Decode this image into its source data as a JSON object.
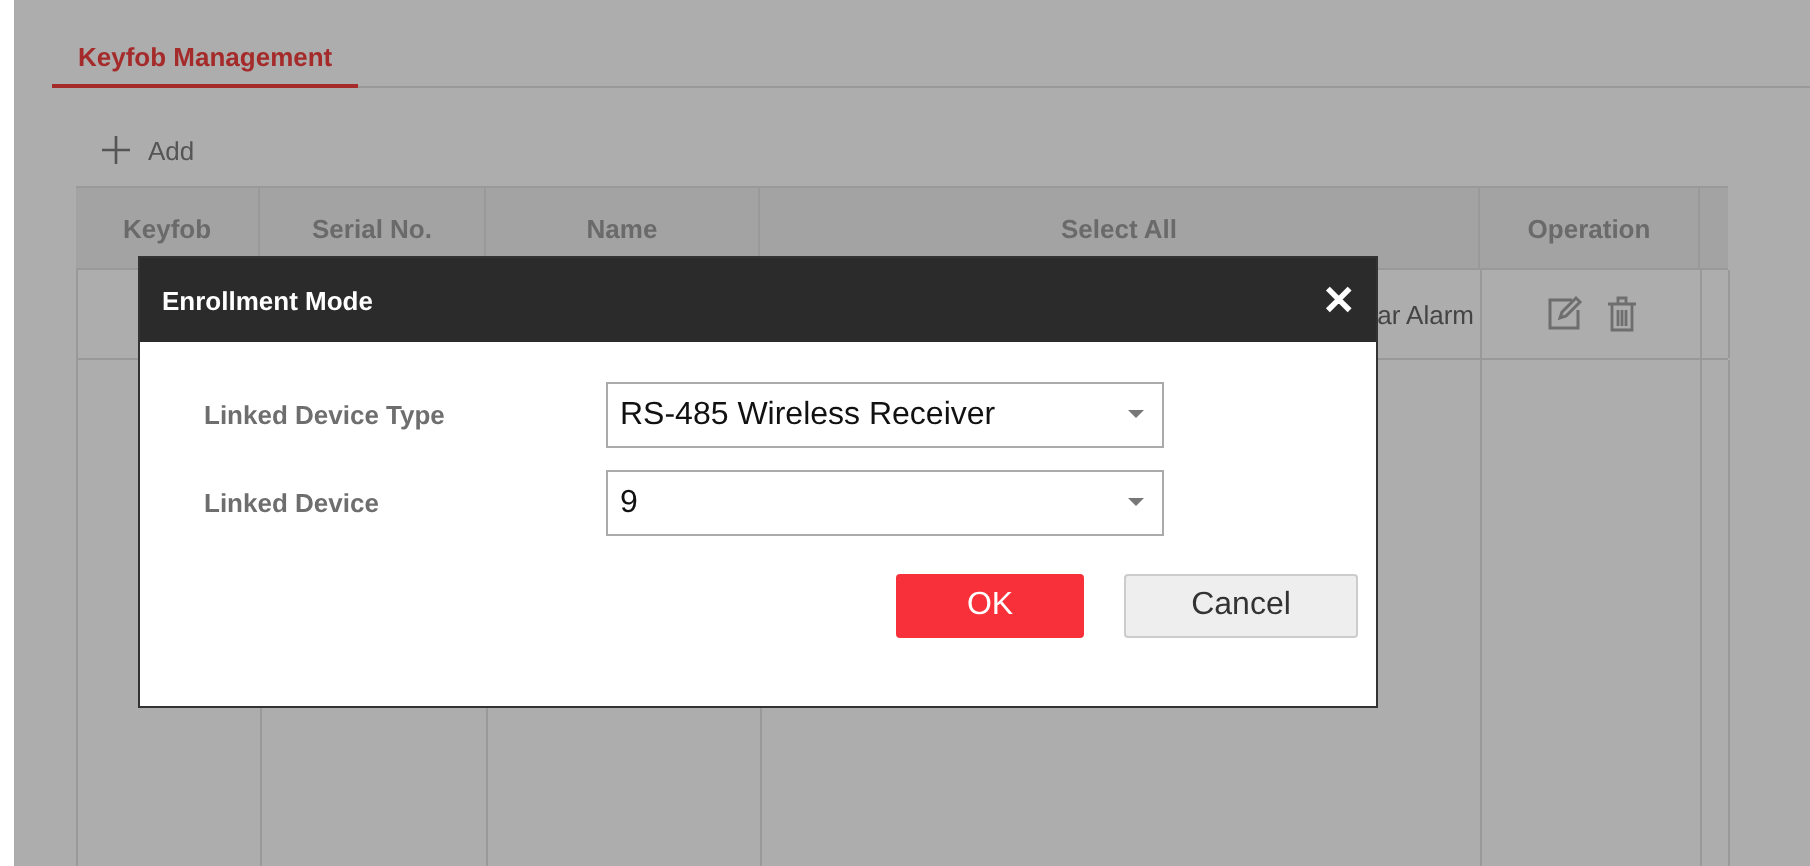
{
  "tabs": [
    {
      "label": "Keyfob Management",
      "selected": true
    }
  ],
  "add_button": {
    "label": "Add"
  },
  "table": {
    "columns": [
      "Keyfob",
      "Serial No.",
      "Name",
      "Select All",
      "Operation"
    ],
    "rows": [
      {
        "cells": [
          "",
          "",
          "",
          "ar Alarm"
        ]
      }
    ]
  },
  "dialog": {
    "title": "Enrollment Mode",
    "close": "✕",
    "fields": [
      {
        "label": "Linked Device Type",
        "value": "RS-485 Wireless Receiver"
      },
      {
        "label": "Linked Device",
        "value": "9"
      }
    ],
    "buttons": [
      {
        "label": "OK",
        "kind": "primary"
      },
      {
        "label": "Cancel",
        "kind": "secondary"
      }
    ]
  }
}
